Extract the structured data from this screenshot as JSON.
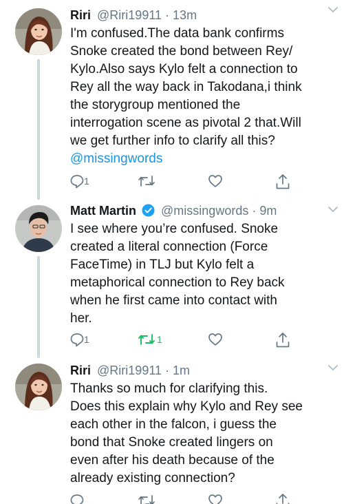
{
  "tweets": [
    {
      "name": "Riri",
      "handle": "@Riri19911",
      "time": "13m",
      "lines": [
        "I'm confused.The data bank confirms",
        "Snoke created the bond between Rey/",
        "Kylo.Also says Kylo felt a connection to",
        "Rey all the way back in Takodana,i think",
        "the storygroup mentioned the",
        "interrogation scene as pivotal 2 that.Will",
        "we get further info to clarify all this?"
      ],
      "mention": "@missingwords",
      "reply_count": "1",
      "retweet_count": "",
      "like_count": ""
    },
    {
      "name": "Matt Martin",
      "handle": "@missingwords",
      "time": "9m",
      "verified": true,
      "lines": [
        "I see where you’re confused. Snoke",
        "created a literal connection (Force",
        "FaceTime) in TLJ but Kylo felt a",
        "metaphorical connection to Rey back",
        "when he first came into contact with",
        "her."
      ],
      "reply_count": "1",
      "retweet_count": "1",
      "retweeted": true,
      "like_count": ""
    },
    {
      "name": "Riri",
      "handle": "@Riri19911",
      "time": "1m",
      "lines": [
        "Thanks so much for clarifying this.",
        "Does this explain why Kylo and Rey see",
        "each other in the falcon, i guess the",
        "bond that Snoke created lingers on",
        "even after his death because of the",
        "already existing connection?"
      ],
      "reply_count": "",
      "retweet_count": "",
      "like_count": ""
    }
  ],
  "separator": "·",
  "colors": {
    "text": "#14171a",
    "secondary": "#657786",
    "link": "#1b95e0",
    "retweet_active": "#17bf63",
    "verified": "#1da1f2",
    "thread_line": "#ccd6dd"
  },
  "icons": [
    "reply-icon",
    "retweet-icon",
    "like-icon",
    "share-icon",
    "chevron-down-icon",
    "verified-badge-icon"
  ]
}
